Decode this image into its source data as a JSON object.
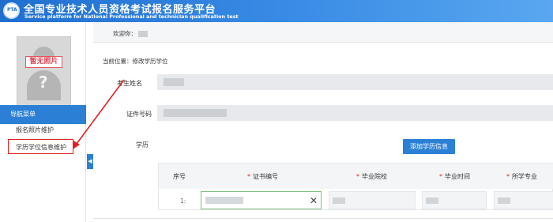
{
  "header": {
    "logo_text": "PTA",
    "title": "全国专业技术人员资格考试报名服务平台",
    "subtitle": "Service platform for National Professional and technician qualification test"
  },
  "sidebar": {
    "photo_badge": "暂无照片",
    "nav_header": "导航菜单",
    "items": [
      {
        "label": "报名照片维护"
      },
      {
        "label": "学历学位信息维护"
      }
    ],
    "collapse_glyph": "◀"
  },
  "welcome": {
    "label": "欢迎你："
  },
  "breadcrumb": "当前位置：修改学历学位",
  "form": {
    "name_label": "考生姓名",
    "id_label": "证件号码",
    "education_label": "学历",
    "add_button_label": "添加学历信息"
  },
  "table": {
    "columns": [
      {
        "label": "序号",
        "required": false
      },
      {
        "label": "证书编号",
        "required": true
      },
      {
        "label": "毕业院校",
        "required": true
      },
      {
        "label": "毕业时间",
        "required": true
      },
      {
        "label": "所学专业",
        "required": true
      }
    ],
    "required_mark": "*",
    "rows": [
      {
        "index": "1:",
        "clear_glyph": "✕"
      }
    ]
  },
  "colors": {
    "header_blue": "#1f6fd0",
    "nav_blue": "#2b80d6",
    "annotation_red": "#e02020"
  }
}
